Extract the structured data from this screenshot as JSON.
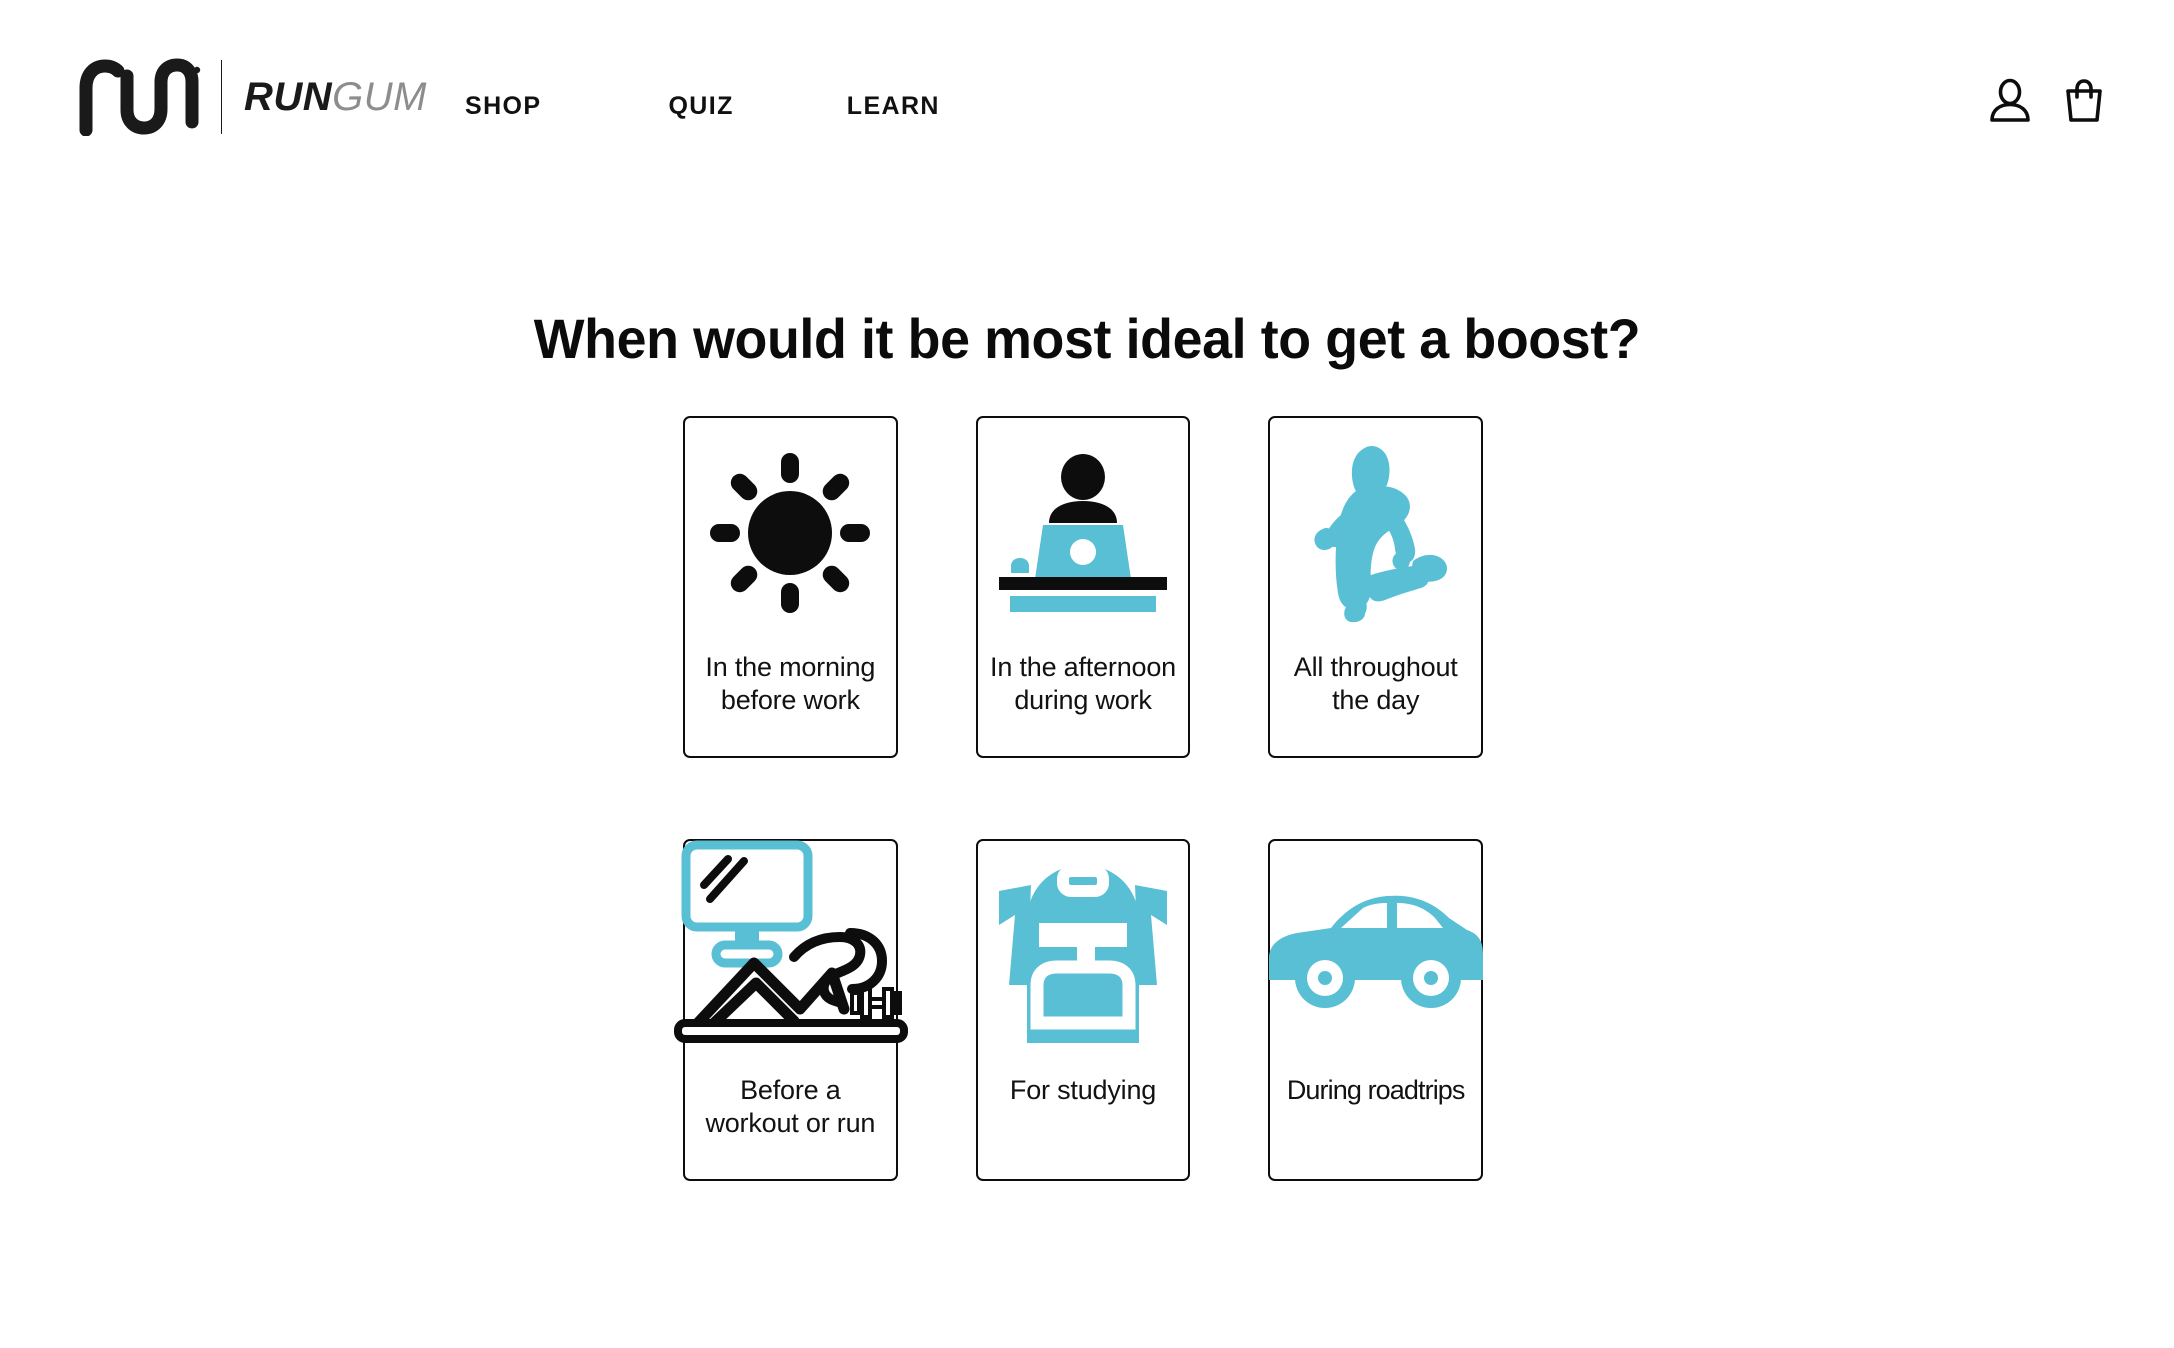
{
  "brand": {
    "logo_mark_name": "run-gum-logomark",
    "word_run": "RUN",
    "word_gum": "GUM"
  },
  "nav": {
    "items": [
      {
        "label": "SHOP",
        "name": "nav-shop"
      },
      {
        "label": "QUIZ",
        "name": "nav-quiz"
      },
      {
        "label": "LEARN",
        "name": "nav-learn"
      }
    ]
  },
  "header_icons": [
    {
      "name": "account-icon",
      "glyph": "person"
    },
    {
      "name": "cart-icon",
      "glyph": "shopping-bag"
    }
  ],
  "main": {
    "question": "When would it be most ideal to get a boost?"
  },
  "colors": {
    "accent_blue": "#59bfd4",
    "ink": "#0d0d0d",
    "logo_gray": "#8d8d8d",
    "background": "#ffffff"
  },
  "options": [
    {
      "id": "morning",
      "label": "In the morning\nbefore work",
      "icon": "sun-icon",
      "icon_colors": [
        "#0d0d0d"
      ]
    },
    {
      "id": "afternoon",
      "label": "In the afternoon\nduring work",
      "icon": "person-at-laptop-icon",
      "icon_colors": [
        "#0d0d0d",
        "#59bfd4"
      ]
    },
    {
      "id": "all-day",
      "label": "All throughout\nthe day",
      "icon": "runner-icon",
      "icon_colors": [
        "#59bfd4"
      ]
    },
    {
      "id": "workout",
      "label": "Before a\nworkout or run",
      "icon": "gym-bench-monitor-icon",
      "icon_colors": [
        "#0d0d0d",
        "#59bfd4"
      ]
    },
    {
      "id": "studying",
      "label": "For studying",
      "icon": "backpack-icon",
      "icon_colors": [
        "#59bfd4"
      ]
    },
    {
      "id": "roadtrips",
      "label": "During roadtrips",
      "icon": "car-icon",
      "icon_colors": [
        "#59bfd4"
      ]
    }
  ]
}
